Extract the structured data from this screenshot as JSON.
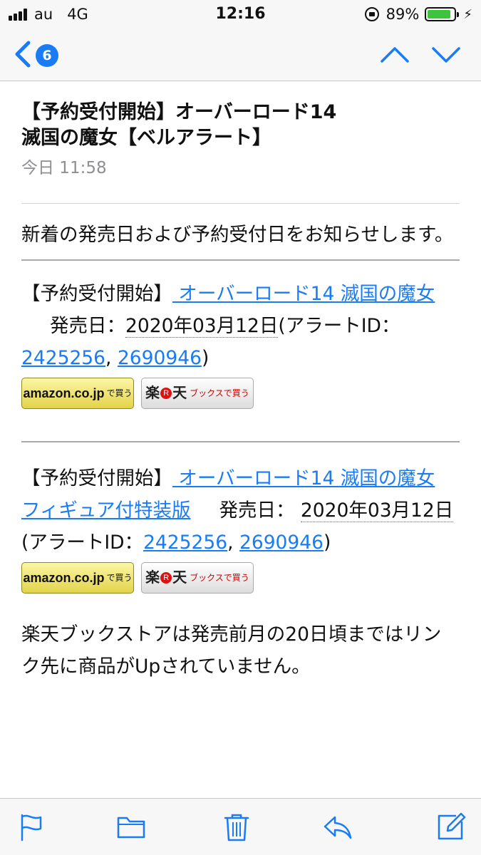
{
  "status_bar": {
    "carrier": "au",
    "network": "4G",
    "time": "12:16",
    "battery_percent_label": "89%",
    "battery_level": 0.89,
    "battery_color": "#3dc33d",
    "icons": [
      "signal-bars-icon",
      "rotation-lock-icon",
      "battery-icon",
      "charging-icon"
    ]
  },
  "nav": {
    "unread_count": "6",
    "accent_color": "#1a7cf5",
    "icons": [
      "back-chevron-icon",
      "previous-message-icon",
      "next-message-icon"
    ]
  },
  "message": {
    "subject_line1": "【予約受付開始】オーバーロード14",
    "subject_line2": "滅国の魔女【ベルアラート】",
    "date": "今日 11:58",
    "intro": "新着の発売日および予約受付日をお知らせします。",
    "items": [
      {
        "prefix": "【予約受付開始】",
        "title_link": " オーバーロード14 滅国の魔女",
        "release_label": "発売日：",
        "release_date": "2020年03月12日",
        "alert_prefix": "(アラートID：",
        "alert_id_1": "2425256",
        "separator": ",",
        "alert_id_2": "2690946",
        "alert_suffix": ")"
      },
      {
        "prefix": "【予約受付開始】",
        "title_link": " オーバーロード14 滅国の魔女 フィギュア付特装版",
        "release_label": "発売日：",
        "release_date": "2020年03月12日",
        "alert_prefix": "(アラートID：",
        "alert_id_1": "2425256",
        "separator": ",",
        "alert_id_2": "2690946",
        "alert_suffix": ")"
      }
    ],
    "amazon_button": {
      "main": "amazon.co.jp",
      "sub": "で買う"
    },
    "rakuten_button": {
      "main_a": "楽",
      "r": "R",
      "main_b": "天",
      "sub": "ブックスで買う"
    },
    "closing": "楽天ブックストアは発売前月の20日頃まではリンク先に商品がUpされていません。"
  },
  "toolbar": {
    "icons": [
      "flag-icon",
      "folder-icon",
      "trash-icon",
      "reply-icon",
      "compose-icon"
    ]
  }
}
